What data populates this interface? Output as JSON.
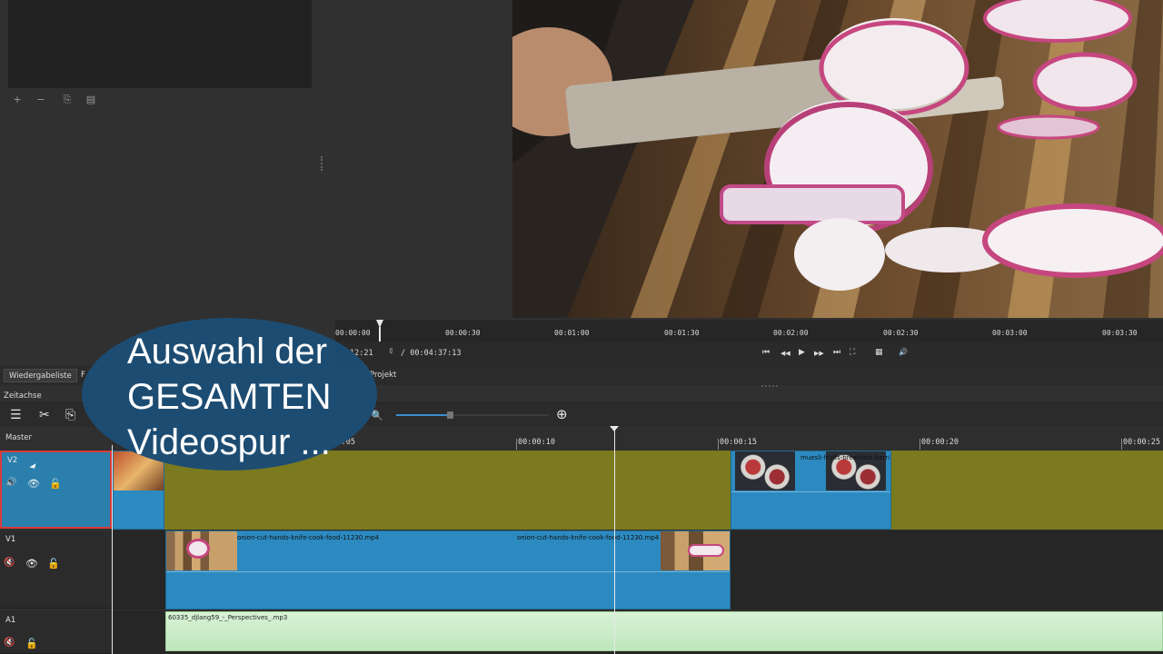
{
  "playlist": {
    "buttons": [
      {
        "name": "add-icon",
        "glyph": "+"
      },
      {
        "name": "remove-icon",
        "glyph": "−"
      },
      {
        "name": "copy-icon",
        "glyph": "⎘"
      },
      {
        "name": "paste-icon",
        "glyph": "▤"
      }
    ]
  },
  "player": {
    "ruler_labels": [
      "00:00:00",
      "00:00:30",
      "00:01:00",
      "00:01:30",
      "00:02:00",
      "00:02:30",
      "00:03:00",
      "00:03:30"
    ],
    "position": "00:00:12:21",
    "position_visible": "12:21",
    "duration": "/ 00:04:37:13",
    "controls": {
      "skip_start": "⏮",
      "rewind": "◀◀",
      "play": "▶",
      "fast_forward": "▶▶",
      "skip_end": "⏭",
      "zoom": "⛶",
      "grid": "▦",
      "volume": "🔊"
    }
  },
  "tabs": {
    "playlist": "Wiedergabeliste",
    "filter": "F",
    "project": "Projekt"
  },
  "timeline": {
    "dock_title": "Zeitachse",
    "master_label": "Master",
    "toolbar": {
      "menu": "☰",
      "cut": "✂",
      "copy": "⎘",
      "zoom_out": "🔍",
      "zoom_in": "⊕"
    },
    "zoom_level": 0.35,
    "ruler_labels": [
      "00:00:05",
      "00:00:10",
      "00:00:15",
      "00:00:20",
      "00:00:25"
    ],
    "tracks": {
      "v2": {
        "name": "V2",
        "mute": "🔊",
        "visible": "👁",
        "lock": "🔓"
      },
      "v1": {
        "name": "V1",
        "mute": "🔇",
        "visible": "👁",
        "lock": "🔓"
      },
      "a1": {
        "name": "A1",
        "mute": "🔇",
        "lock": "🔓"
      }
    },
    "clips": {
      "v2_clip": "muesli-fruits-breakfast-berri",
      "v1_clip_a": "onion-cut-hands-knife-cook-food-11230.mp4",
      "v1_clip_b": "onion-cut-hands-knife-cook-food-11230.mp4",
      "a1_clip": "60335_djlang59_-_Perspectives_.mp3"
    }
  },
  "overlay": {
    "text": "Auswahl der\nGESAMTEN\nVideospur ..."
  },
  "colors": {
    "accent": "#2c8ac0",
    "selection_border": "#d93a3a",
    "v2_lane": "#7b7a1f",
    "audio_clip": "#d8f2d6",
    "bubble": "#1d4d73"
  }
}
